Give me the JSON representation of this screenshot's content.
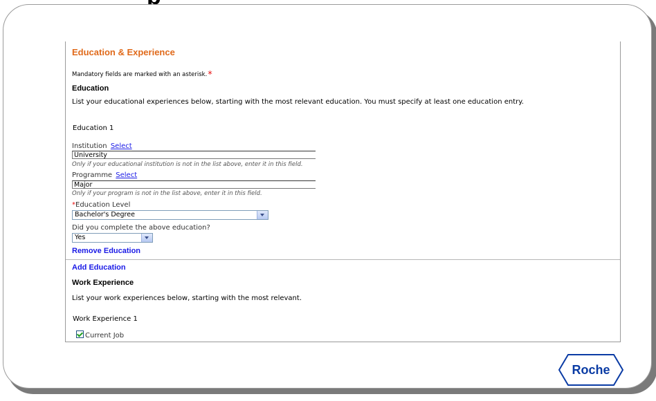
{
  "top_fragment": "p",
  "section": {
    "title": "Education & Experience",
    "mandatory_note": "Mandatory fields are marked with an asterisk.",
    "asterisk": "*"
  },
  "education": {
    "heading": "Education",
    "description": "List your educational experiences below, starting with the most relevant education. You must specify at least one education entry.",
    "entry_title": "Education 1",
    "institution": {
      "label": "Institution",
      "select_link": "Select",
      "value": "University",
      "hint": "Only if your educational institution is not in the list above, enter it in this field."
    },
    "programme": {
      "label": "Programme",
      "select_link": "Select",
      "value": "Major",
      "hint": "Only if your program is not in the list above, enter it in this field."
    },
    "education_level": {
      "label": "Education Level",
      "required_mark": "*",
      "value": "Bachelor's Degree"
    },
    "completed": {
      "label": "Did you complete the above education?",
      "value": "Yes"
    },
    "remove_link": "Remove Education",
    "add_link": "Add Education"
  },
  "work": {
    "heading": "Work Experience",
    "description": "List your work experiences below, starting with the most relevant.",
    "entry_title": "Work Experience 1",
    "current_job": {
      "label": "Current Job",
      "checked": true
    }
  },
  "logo": {
    "text": "Roche",
    "color": "#0a3ba4"
  },
  "colors": {
    "section_title": "#e06a1b",
    "link": "#1a1ae6",
    "required": "#e81010"
  }
}
